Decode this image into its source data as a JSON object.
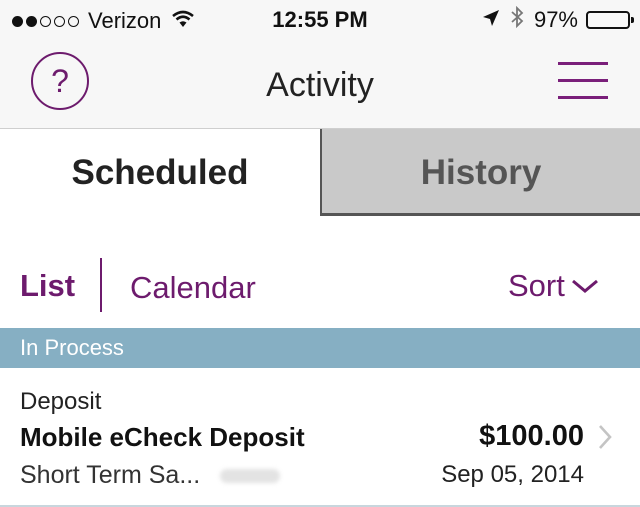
{
  "status_bar": {
    "carrier": "Verizon",
    "time": "12:55 PM",
    "battery": "97%",
    "battery_level": 0.97,
    "signal_bars_filled": 2,
    "signal_bars_total": 5
  },
  "nav": {
    "help_icon": "?",
    "title": "Activity",
    "menu_icon": "hamburger-menu-icon"
  },
  "tabs": [
    {
      "label": "Scheduled",
      "selected": true
    },
    {
      "label": "History",
      "selected": false
    }
  ],
  "view": {
    "list_label": "List",
    "calendar_label": "Calendar",
    "sort_label": "Sort"
  },
  "section": {
    "title": "In Process"
  },
  "transactions": [
    {
      "type": "Deposit",
      "name": "Mobile eCheck Deposit",
      "amount": "$100.00",
      "account": "Short Term Sa...",
      "date": "Sep 05, 2014"
    }
  ],
  "colors": {
    "accent": "#6d1b6d",
    "section_header": "#86afc3",
    "inactive_tab": "#c9c9c9"
  }
}
